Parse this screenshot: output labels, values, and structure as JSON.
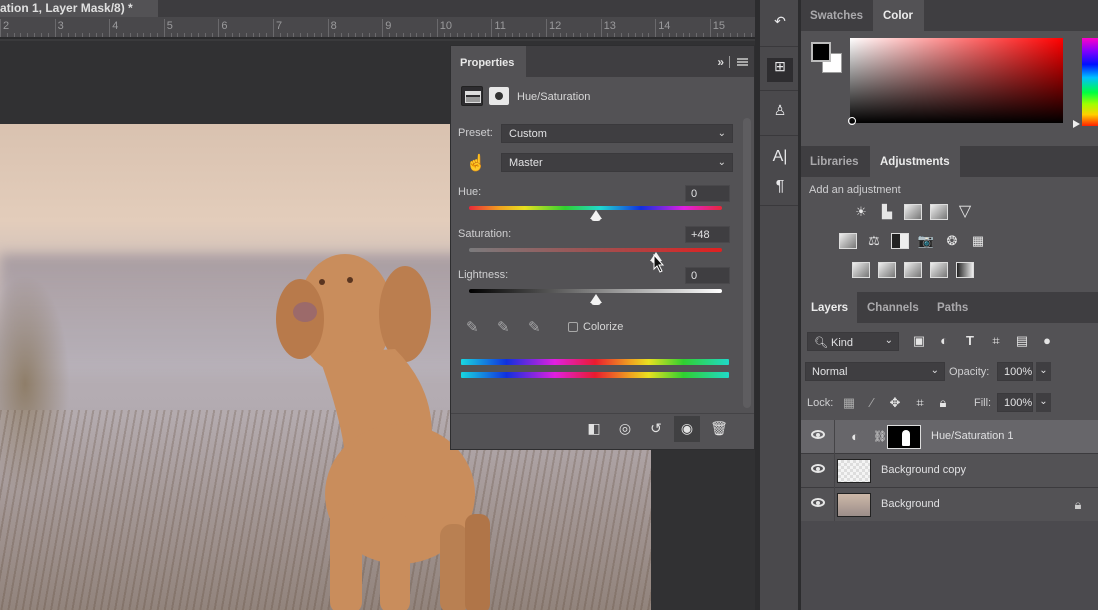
{
  "document": {
    "tab_title": "ation 1, Layer Mask/8) *",
    "ruler_labels": [
      "2",
      "3",
      "4",
      "5",
      "6",
      "7",
      "8",
      "9",
      "10",
      "11",
      "12",
      "13",
      "14",
      "15"
    ]
  },
  "properties": {
    "tab_label": "Properties",
    "collapse_glyph": "»",
    "adjustment_title": "Hue/Saturation",
    "preset_label": "Preset:",
    "preset_value": "Custom",
    "channel_value": "Master",
    "hue": {
      "label": "Hue:",
      "value": "0",
      "fraction": 0.5
    },
    "saturation": {
      "label": "Saturation:",
      "value": "+48",
      "fraction": 0.74
    },
    "lightness": {
      "label": "Lightness:",
      "value": "0",
      "fraction": 0.5
    },
    "colorize_label": "Colorize",
    "colorize_checked": false,
    "footer_icons": [
      "clip-to-layer-icon",
      "view-previous-state-icon",
      "reset-icon",
      "visibility-icon",
      "delete-icon"
    ]
  },
  "toolstrip": {
    "icons": [
      "history-icon",
      "adjustment-presets-icon",
      "clone-source-icon",
      "character-icon",
      "paragraph-icon"
    ]
  },
  "color_panel": {
    "tabs": [
      {
        "label": "Swatches",
        "active": false
      },
      {
        "label": "Color",
        "active": true
      }
    ],
    "foreground": "#000000",
    "background": "#ffffff",
    "hue_color": "#ff0000"
  },
  "adjustments_panel": {
    "tabs": [
      {
        "label": "Libraries",
        "active": false
      },
      {
        "label": "Adjustments",
        "active": true
      }
    ],
    "subtitle": "Add an adjustment",
    "rows": [
      [
        "brightness-contrast-icon",
        "levels-icon",
        "curves-icon",
        "exposure-icon",
        "vibrance-icon"
      ],
      [
        "hue-saturation-icon",
        "color-balance-icon",
        "black-white-icon",
        "photo-filter-icon",
        "channel-mixer-icon",
        "color-lookup-icon"
      ],
      [
        "invert-icon",
        "posterize-icon",
        "threshold-icon",
        "selective-color-icon",
        "gradient-map-icon"
      ]
    ]
  },
  "layers_panel": {
    "tabs": [
      {
        "label": "Layers",
        "active": true
      },
      {
        "label": "Channels",
        "active": false
      },
      {
        "label": "Paths",
        "active": false
      }
    ],
    "filter_value": "Kind",
    "blend_mode": "Normal",
    "opacity_label": "Opacity:",
    "opacity_value": "100%",
    "lock_label": "Lock:",
    "fill_label": "Fill:",
    "fill_value": "100%",
    "layers": [
      {
        "name": "Hue/Saturation 1",
        "visible": true,
        "selected": true,
        "type": "adjustment"
      },
      {
        "name": "Background copy",
        "visible": true,
        "selected": false,
        "type": "pixel"
      },
      {
        "name": "Background",
        "visible": true,
        "selected": false,
        "type": "pixel",
        "locked": true
      }
    ]
  }
}
